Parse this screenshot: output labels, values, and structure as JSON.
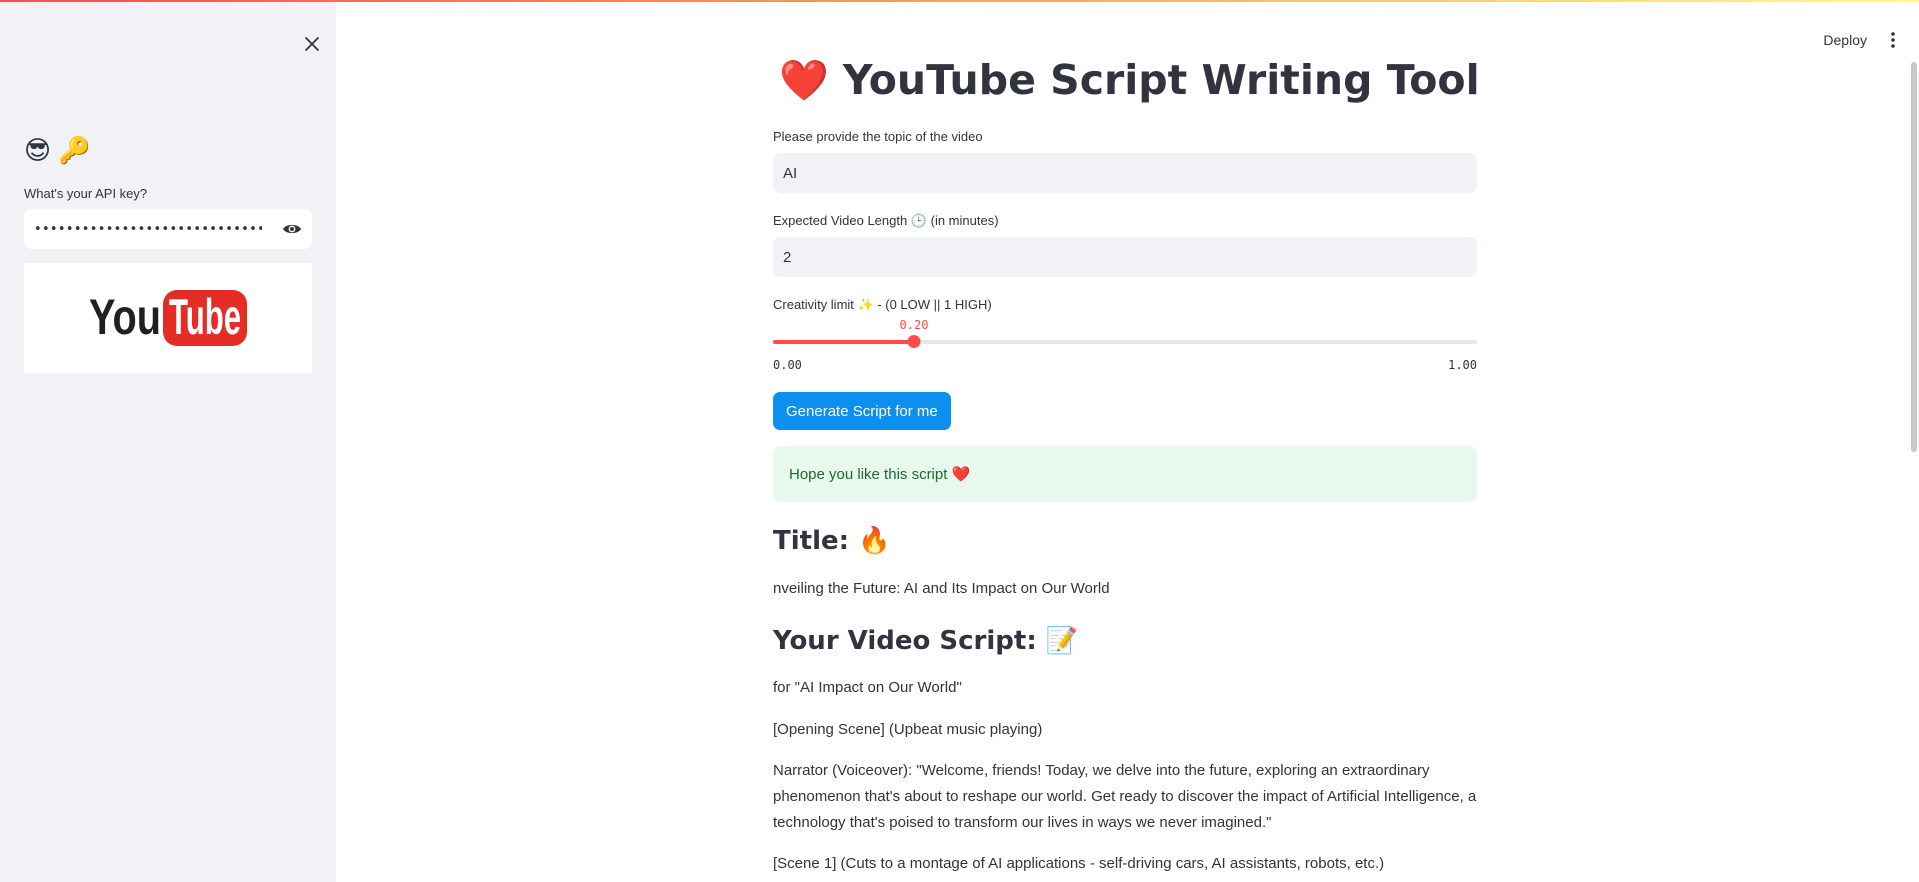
{
  "sidebar": {
    "emojis": "😎 🔑",
    "api_label": "What's your API key?",
    "api_value": "••••••••••••••••••••••••••••••••••••••••"
  },
  "header": {
    "deploy_label": "Deploy"
  },
  "main": {
    "title_emoji": "❤️",
    "title": "YouTube Script Writing Tool",
    "topic_label": "Please provide the topic of the video",
    "topic_value": "AI",
    "length_label": "Expected Video Length 🕒 (in minutes)",
    "length_value": "2",
    "creativity_label": "Creativity limit ✨ - (0 LOW || 1 HIGH)",
    "slider": {
      "value": 0.2,
      "value_label": "0.20",
      "min_label": "0.00",
      "max_label": "1.00",
      "min": 0,
      "max": 1
    },
    "generate_button": "Generate Script for me",
    "success_message": "Hope you like this script ❤️",
    "title_heading": "Title: 🔥",
    "title_text": "nveiling the Future: AI and Its Impact on Our World",
    "script_heading": "Your Video Script: 📝",
    "script_paragraphs": [
      "for \"AI Impact on Our World\"",
      "[Opening Scene] (Upbeat music playing)",
      "Narrator (Voiceover): \"Welcome, friends! Today, we delve into the future, exploring an extraordinary phenomenon that's about to reshape our world. Get ready to discover the impact of Artificial Intelligence, a technology that's poised to transform our lives in ways we never imagined.\"",
      "[Scene 1] (Cuts to a montage of AI applications - self-driving cars, AI assistants, robots, etc.)"
    ]
  },
  "colors": {
    "accent": "#ff4b4b",
    "button": "#0d8ff0",
    "success_bg": "#e8f8ec",
    "success_text": "#1a6b33",
    "sidebar_bg": "#f0f2f6"
  },
  "icons": [
    "close-icon",
    "eye-icon",
    "more-vertical-icon",
    "youtube-logo"
  ]
}
